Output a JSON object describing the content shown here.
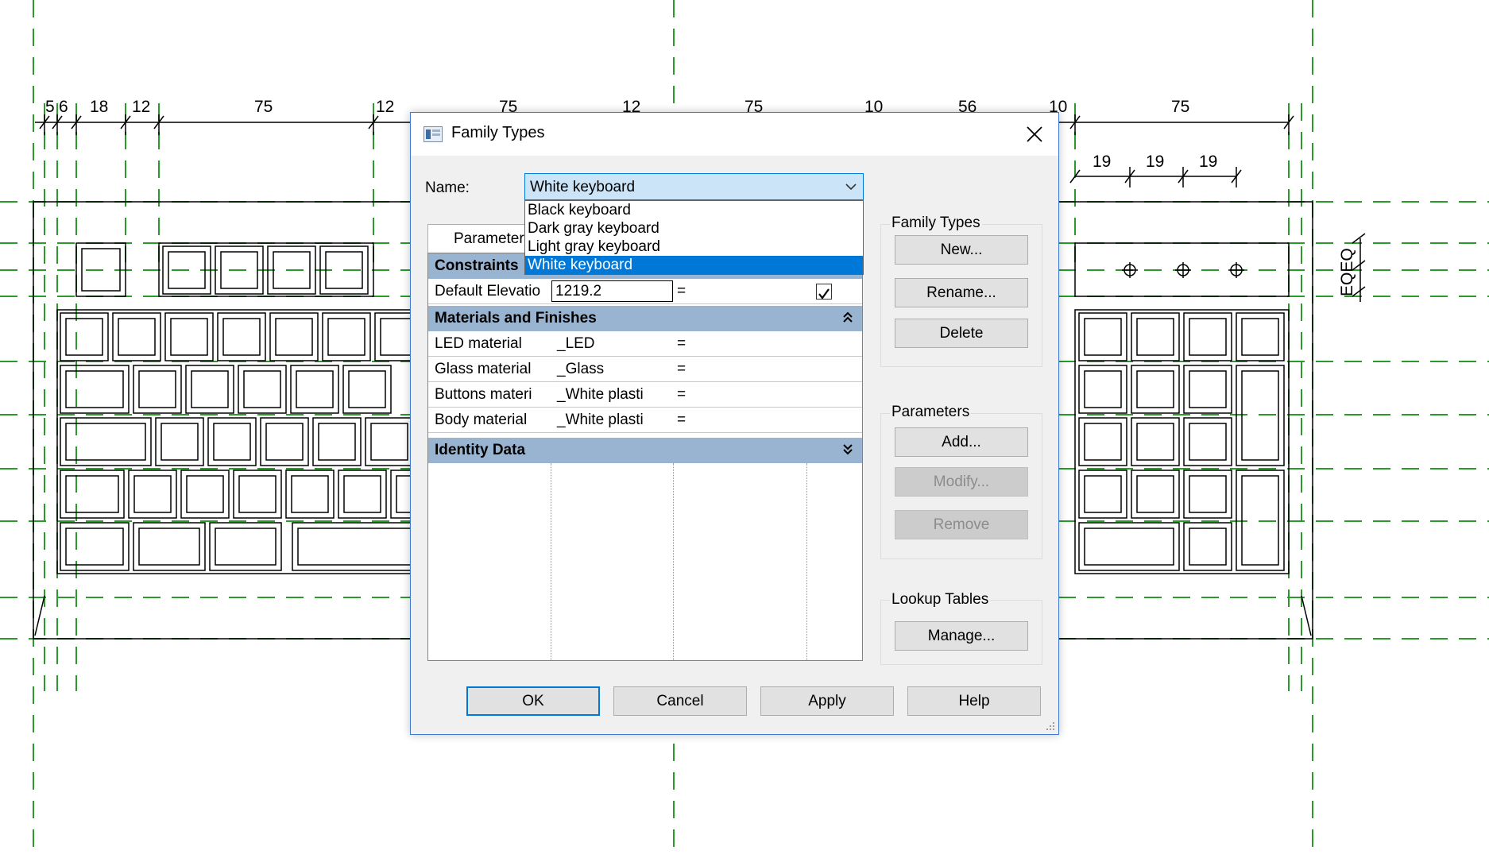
{
  "dimensions": {
    "top": [
      "5",
      "6",
      "18",
      "12",
      "75",
      "12",
      "75",
      "12",
      "75",
      "10",
      "56",
      "10",
      "75"
    ],
    "right": [
      "19",
      "19",
      "19"
    ],
    "side": "EQEQ"
  },
  "dialog": {
    "title": "Family Types",
    "name_label": "Name:",
    "name_value": "White keyboard",
    "name_options": [
      "Black keyboard",
      "Dark gray keyboard",
      "Light gray keyboard",
      "White keyboard"
    ],
    "tab_label": "Parameter",
    "groups": {
      "constraints": "Constraints",
      "materials": "Materials and Finishes",
      "identity": "Identity Data"
    },
    "rows": {
      "elevation": {
        "name": "Default Elevatio",
        "value": "1219.2",
        "formula": "="
      },
      "materials": [
        {
          "name": "LED material",
          "value": "_LED",
          "formula": "="
        },
        {
          "name": "Glass material",
          "value": "_Glass",
          "formula": "="
        },
        {
          "name": "Buttons materi",
          "value": "_White plasti",
          "formula": "="
        },
        {
          "name": "Body material",
          "value": "_White plasti",
          "formula": "="
        }
      ]
    },
    "family_types": {
      "title": "Family Types",
      "new": "New...",
      "rename": "Rename...",
      "delete": "Delete"
    },
    "parameters": {
      "title": "Parameters",
      "add": "Add...",
      "modify": "Modify...",
      "remove": "Remove"
    },
    "lookup": {
      "title": "Lookup Tables",
      "manage": "Manage..."
    },
    "buttons": {
      "ok": "OK",
      "cancel": "Cancel",
      "apply": "Apply",
      "help": "Help"
    }
  }
}
